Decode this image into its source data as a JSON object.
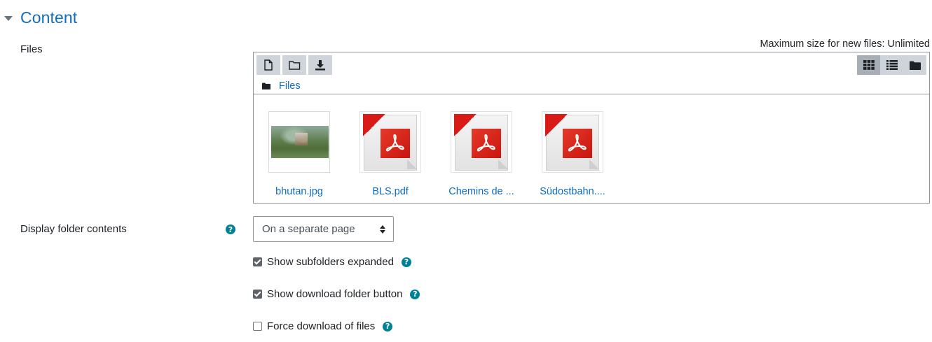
{
  "section": {
    "title": "Content"
  },
  "files_field": {
    "label": "Files",
    "max_size": "Maximum size for new files: Unlimited",
    "path_label": "Files",
    "files": [
      {
        "name": "bhutan.jpg",
        "type": "image"
      },
      {
        "name": "BLS.pdf",
        "type": "pdf"
      },
      {
        "name": "Chemins de ...",
        "type": "pdf"
      },
      {
        "name": "Südostbahn....",
        "type": "pdf"
      }
    ]
  },
  "display_folder": {
    "label": "Display folder contents",
    "selected": "On a separate page"
  },
  "options": {
    "show_subfolders": {
      "label": "Show subfolders expanded",
      "checked": true
    },
    "show_download": {
      "label": "Show download folder button",
      "checked": true
    },
    "force_download": {
      "label": "Force download of files",
      "checked": false
    }
  },
  "colors": {
    "accent": "#0f6cbf",
    "help": "#008196"
  }
}
